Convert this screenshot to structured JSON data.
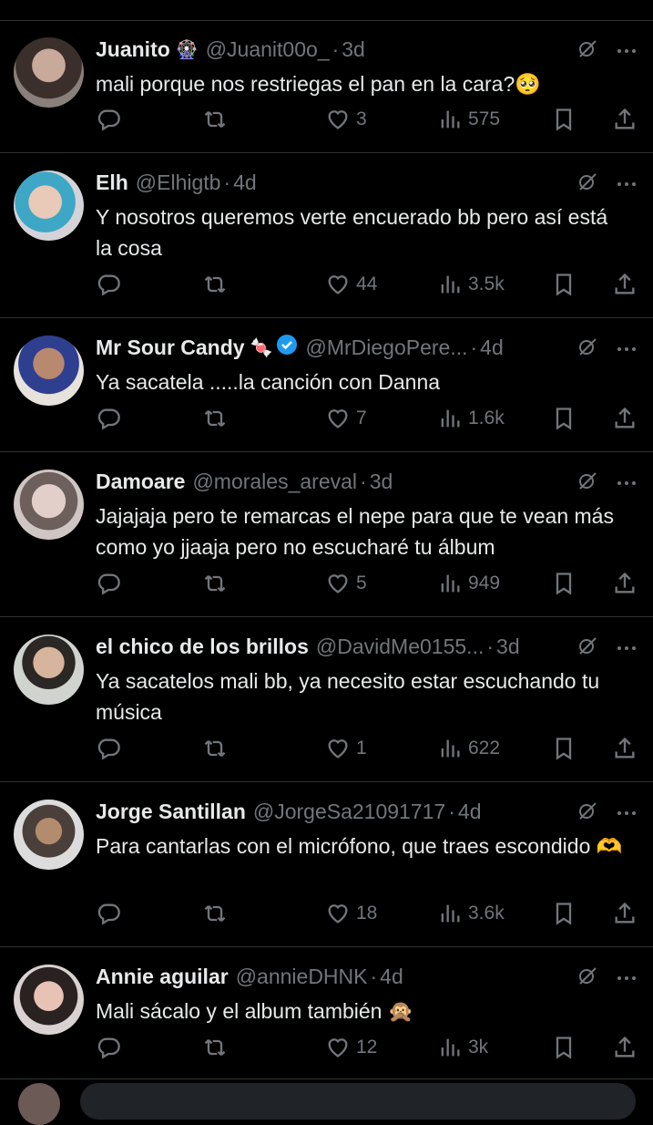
{
  "replies": [
    {
      "name": "Juanito",
      "badge_icon": "ferris-wheel-emoji",
      "handle": "@Juanit00o_",
      "time": "3d",
      "text": "mali porque nos restriegas el pan en la cara?🥺",
      "replies_count": "",
      "retweets": "",
      "likes": "3",
      "views": "575"
    },
    {
      "name": "Elh",
      "handle": "@Elhigtb",
      "time": "4d",
      "text": "Y nosotros queremos verte encuerado bb pero así está la cosa",
      "replies_count": "",
      "retweets": "",
      "likes": "44",
      "views": "3.5k"
    },
    {
      "name": "Mr Sour Candy",
      "badge_icon": "candy-emoji",
      "verified": true,
      "handle": "@MrDiegoPere...",
      "time": "4d",
      "text": "Ya sacatela .....la canción con Danna",
      "replies_count": "",
      "retweets": "",
      "likes": "7",
      "views": "1.6k"
    },
    {
      "name": "Damoare",
      "handle": "@morales_areval",
      "time": "3d",
      "text": "Jajajaja pero te remarcas el nepe para que te vean más como yo jjaaja pero no escucharé tu álbum",
      "replies_count": "",
      "retweets": "",
      "likes": "5",
      "views": "949"
    },
    {
      "name": "el chico de los brillos",
      "handle": "@DavidMe0155...",
      "time": "3d",
      "text": "Ya sacatelos mali bb, ya necesito estar escuchando tu música",
      "replies_count": "",
      "retweets": "",
      "likes": "1",
      "views": "622"
    },
    {
      "name": "Jorge Santillan",
      "handle": "@JorgeSa21091717",
      "time": "4d",
      "text": "Para cantarlas con el micrófono, que traes escondido 🫶",
      "replies_count": "",
      "retweets": "",
      "likes": "18",
      "views": "3.6k"
    },
    {
      "name": "Annie aguilar",
      "handle": "@annieDHNK",
      "time": "4d",
      "text": "Mali sácalo y el album también 🙊",
      "replies_count": "",
      "retweets": "",
      "likes": "12",
      "views": "3k"
    }
  ],
  "colors": {
    "background": "#000000",
    "text": "#e7e9ea",
    "muted": "#71767b",
    "divider": "#2f3336",
    "verified": "#1d9bf0"
  }
}
